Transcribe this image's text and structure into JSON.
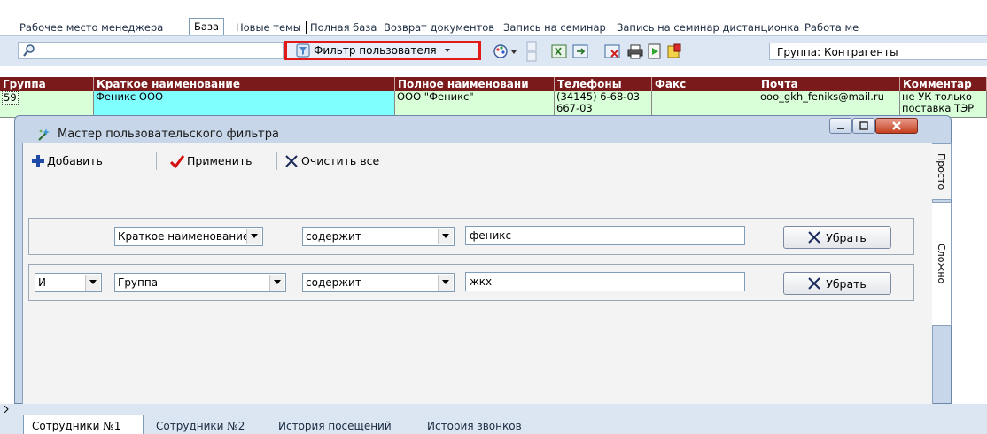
{
  "top_tabs": [
    {
      "label": "Рабочее место менеджера",
      "active": false
    },
    {
      "label": "База",
      "active": true
    },
    {
      "label": "Новые темы",
      "active": false
    },
    {
      "label": "Полная база",
      "active": false
    },
    {
      "label": "Возврат документов",
      "active": false
    },
    {
      "label": "Запись на семинар",
      "active": false
    },
    {
      "label": "Запись на семинар дистанционка",
      "active": false
    },
    {
      "label": "Работа ме",
      "active": false
    }
  ],
  "toolbar": {
    "search_value": "",
    "filter_button_label": "Фильтр пользователя",
    "group_label": "Группа: Контрагенты",
    "icons": [
      "search-icon",
      "filter-icon",
      "color-palette-icon",
      "refresh-icon",
      "export-excel-icon",
      "export-icon",
      "delete-excel-icon",
      "print-icon",
      "play-icon",
      "report-icon"
    ]
  },
  "grid": {
    "columns": [
      "Группа",
      "Краткое наименование",
      "Полное наименовани",
      "Телефоны",
      "Факс",
      "Почта",
      "Комментар"
    ],
    "rows": [
      {
        "group": "59",
        "short_name": "Феникс ООО",
        "full_name": "ООО \"Феникс\"",
        "phone_line1": "(34145) 6-68-03",
        "phone_line2": "667-03",
        "fax": "",
        "email": "ooo_gkh_feniks@mail.ru",
        "comment_line1": "не УК только",
        "comment_line2": "поставка ТЭР"
      }
    ]
  },
  "dialog": {
    "title": "Мастер пользовательского фильтра",
    "toolbar": {
      "add_label": "Добавить",
      "apply_label": "Применить",
      "clear_label": "Очистить все"
    },
    "filters": [
      {
        "logic": "",
        "field": "Краткое наименование",
        "operator": "содержит",
        "value": "феникс",
        "remove_label": "Убрать"
      },
      {
        "logic": "И",
        "field": "Группа",
        "operator": "содержит",
        "value": "жкх",
        "remove_label": "Убрать"
      }
    ],
    "side_tabs": [
      {
        "label": "Просто",
        "active": false
      },
      {
        "label": "Сложно",
        "active": true
      }
    ]
  },
  "bottom_tabs": [
    {
      "label": "Сотрудники №1",
      "active": true
    },
    {
      "label": "Сотрудники №2",
      "active": false
    },
    {
      "label": "История посещений",
      "active": false
    },
    {
      "label": "История звонков",
      "active": false
    }
  ],
  "colors": {
    "grid_header": "#7a1a1a",
    "selected_row_cyan": "#80ffff",
    "row_light_green": "#d8ffd8",
    "highlight_border": "#e31a1a",
    "toolbar_bg": "#dce7f3",
    "dialog_frame": "#c7d6e8"
  }
}
